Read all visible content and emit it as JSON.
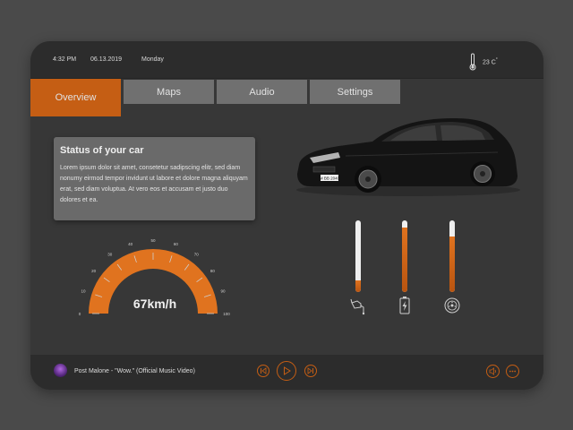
{
  "status_bar": {
    "time": "4:32 PM",
    "date": "06.13.2019",
    "day": "Monday",
    "temperature": "23 C",
    "temperature_unit_mark": "°",
    "thermometer_icon": "thermometer-icon"
  },
  "tabs": [
    {
      "label": "Overview",
      "active": true
    },
    {
      "label": "Maps",
      "active": false
    },
    {
      "label": "Audio",
      "active": false
    },
    {
      "label": "Settings",
      "active": false
    }
  ],
  "status_card": {
    "title": "Status of your car",
    "body": "Lorem ipsum dolor sit amet, consetetur sadipscing elitr, sed diam nonumy eirmod tempor invidunt ut labore et dolore magna aliquyam erat, sed diam voluptua. At vero eos et accusam et justo duo dolores et ea."
  },
  "car": {
    "plate": "M BB 2040"
  },
  "speedometer": {
    "speed_label": "67km/h",
    "speed_value": 67,
    "ticks": [
      "0",
      "10",
      "20",
      "30",
      "40",
      "50",
      "60",
      "70",
      "80",
      "90",
      "100"
    ]
  },
  "levels": [
    {
      "name": "fuel",
      "icon": "fuel-pump-icon",
      "value": 0.16
    },
    {
      "name": "battery",
      "icon": "battery-charging-icon",
      "value": 0.9
    },
    {
      "name": "brake",
      "icon": "brake-disc-icon",
      "value": 0.78
    }
  ],
  "player": {
    "track": "Post Malone - \"Wow.\" (Official Music Video)",
    "album_icon": "album-art-icon",
    "controls": [
      "previous-icon",
      "play-icon",
      "next-icon",
      "volume-icon",
      "more-icon"
    ]
  },
  "colors": {
    "accent": "#c55e14",
    "background": "#373737",
    "bar": "#2c2c2c"
  }
}
